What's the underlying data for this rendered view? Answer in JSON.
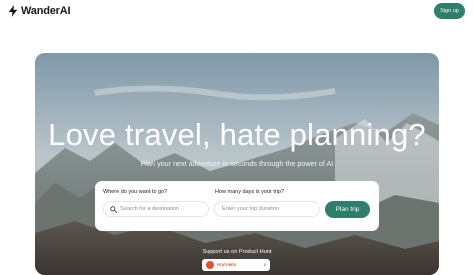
{
  "header": {
    "brand_name": "WanderAI",
    "signup_label": "Sign up",
    "accent_color": "#2f7d6b"
  },
  "hero": {
    "headline": "Love travel, hate planning?",
    "subheadline": "Plan your next adventure in seconds through the power of AI"
  },
  "search": {
    "destination_label": "Where do you want to go?",
    "destination_placeholder": "Search for a destination",
    "days_label": "How many days is your trip?",
    "days_placeholder": "Enter your trip duration",
    "submit_label": "Plan trip"
  },
  "product_hunt": {
    "label": "Support us on Product Hunt",
    "badge_text": "FEATURED",
    "badge_count": "6",
    "brand_color": "#da552f"
  }
}
